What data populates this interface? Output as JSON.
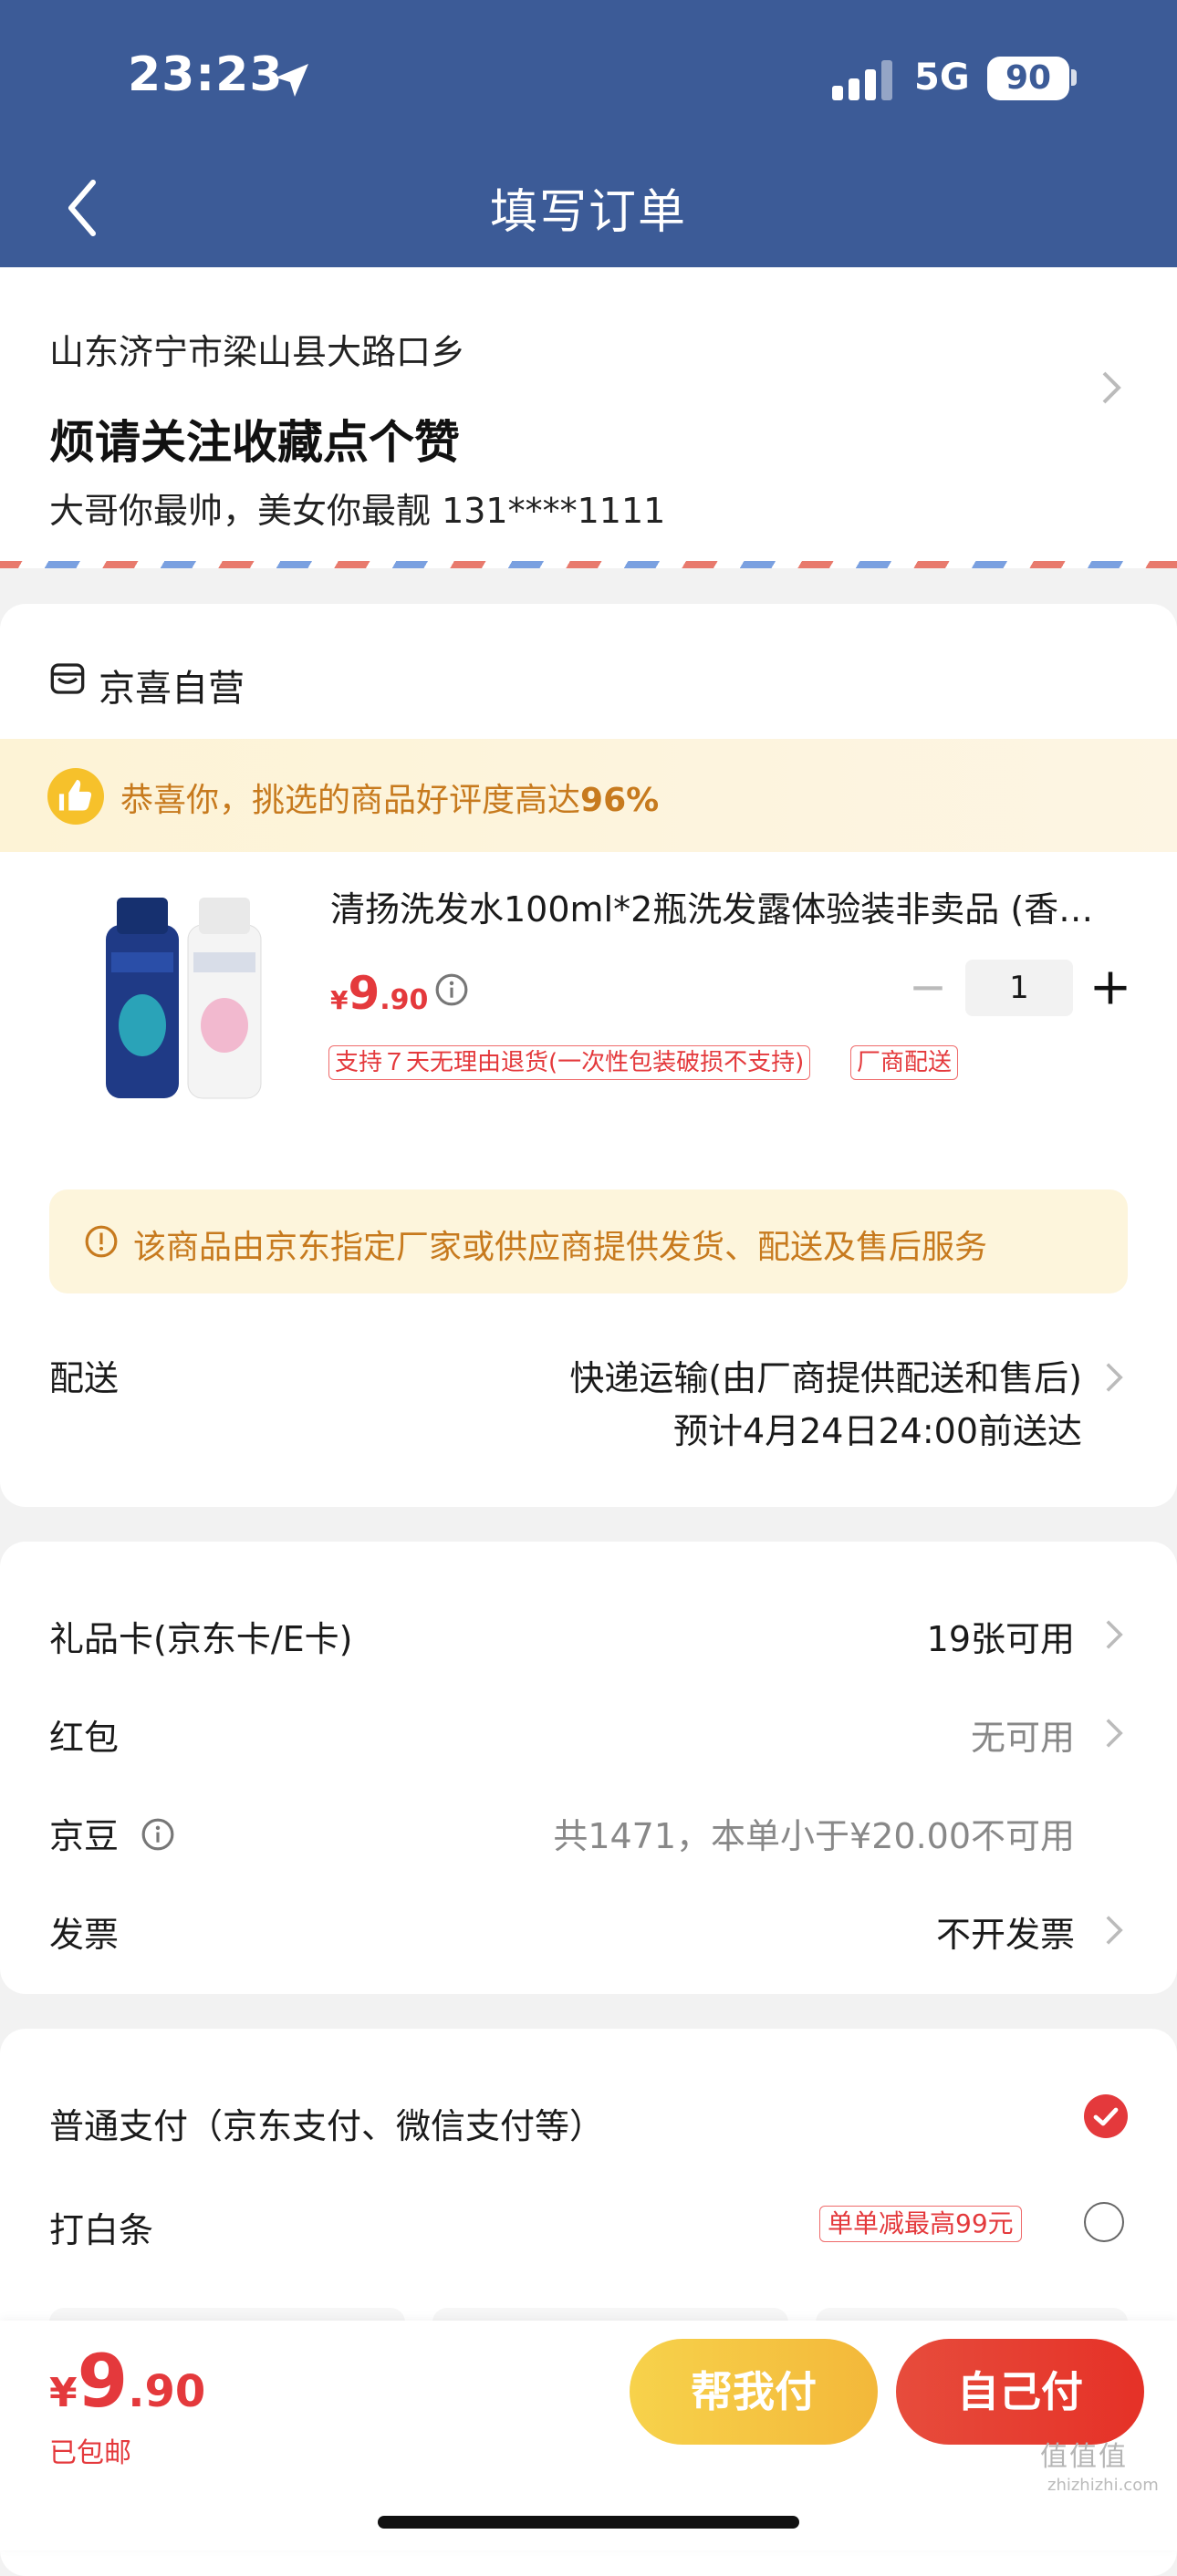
{
  "status_bar": {
    "time": "23:23",
    "network": "5G",
    "battery": "90"
  },
  "nav": {
    "title": "填写订单"
  },
  "address": {
    "region": "山东济宁市梁山县大路口乡",
    "detail": "烦请关注收藏点个赞",
    "contact": "大哥你最帅，美女你最靓 131****1111"
  },
  "shop": {
    "name": "京喜自营",
    "praise_text": "恭喜你，挑选的商品好评度高达",
    "praise_pct": "96%"
  },
  "product": {
    "title": "清扬洗发水100ml*2瓶洗发露体验装非卖品 (香…",
    "price_currency": "¥",
    "price_int": "9",
    "price_dec": ".90",
    "quantity": "1",
    "tags": [
      "支持７天无理由退货(一次性包装破损不支持)",
      "厂商配送"
    ]
  },
  "notice": "该商品由京东指定厂家或供应商提供发货、配送及售后服务",
  "shipping": {
    "label": "配送",
    "method": "快递运输(由厂商提供配送和售后)",
    "eta": "预计4月24日24:00前送达"
  },
  "perks": [
    {
      "label": "礼品卡(京东卡/E卡)",
      "value": "19张可用"
    },
    {
      "label": "红包",
      "value": "无可用"
    },
    {
      "label": "京豆",
      "value": "共1471，本单小于¥20.00不可用"
    },
    {
      "label": "发票",
      "value": "不开发票"
    }
  ],
  "payment": [
    {
      "label": "普通支付（京东支付、微信支付等）",
      "selected": true
    },
    {
      "label": "打白条",
      "promo": "单单减最高99元",
      "selected": false
    }
  ],
  "footer": {
    "currency": "¥",
    "total_int": "9",
    "total_dec": ".90",
    "shipping_note": "已包邮",
    "help_pay_label": "帮我付",
    "self_pay_label": "自己付"
  },
  "watermark": {
    "main": "值值值",
    "sub": "zhizhizhi.com"
  },
  "colors": {
    "header_bg": "#3c5b97",
    "accent_red": "#e4393c",
    "accent_orange": "#c77a1e",
    "help_btn": "#f3b83a"
  }
}
